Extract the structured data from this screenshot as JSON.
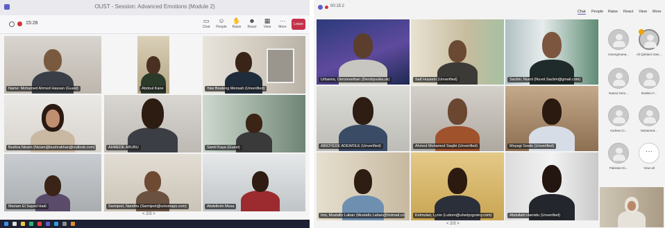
{
  "left_window": {
    "title": "OUST - Session: Advanced Emotions (Module 2)",
    "timer": "15:28",
    "toolbar": [
      {
        "label": "Chat",
        "icon": "chat-icon"
      },
      {
        "label": "People",
        "icon": "people-icon"
      },
      {
        "label": "Raise",
        "icon": "raise-hand-icon"
      },
      {
        "label": "React",
        "icon": "react-icon"
      },
      {
        "label": "View",
        "icon": "view-icon"
      },
      {
        "label": "More",
        "icon": "more-icon"
      },
      {
        "label": "Camera",
        "icon": "camera-icon"
      }
    ],
    "leave_label": "Leave",
    "tiles": [
      {
        "name": "Name: Mohamed Ahmed Hassan (Guest)"
      },
      {
        "name": "Abdoul Kane"
      },
      {
        "name": "Yaw Boateng Mensah (Unverified)"
      },
      {
        "name": "Bushra Nizam (Nizam@bushrakhan@outlook.com)"
      },
      {
        "name": "AHMEDE ABUBU"
      },
      {
        "name": "Samil Kaya (Guest)"
      },
      {
        "name": "Mariam El Sayed Hadi"
      },
      {
        "name": "Sarmjeet, Nandhu (Sarmjeet@uniomaps.com)"
      },
      {
        "name": "Abdelkrim Musa"
      }
    ],
    "pager": "< 2/3 >",
    "taskbar_icons": [
      "start-icon",
      "search-icon",
      "files-icon",
      "browser-icon",
      "mail-icon",
      "teams-icon",
      "store-icon",
      "settings-icon",
      "photos-icon"
    ]
  },
  "right_window": {
    "timer": "00:15:2",
    "tabs": [
      "Chat",
      "People",
      "Raise",
      "React",
      "View",
      "More"
    ],
    "tiles": [
      {
        "name": "Urbanns, Derorevethan (Derobyuoka.uk)"
      },
      {
        "name": "Saif Hussein (Unverified)"
      },
      {
        "name": "Sacbin, Nuvol (Nuvol.Sacbin@gmail.com)"
      },
      {
        "name": "ABIOYEDE ADEWOLE (Unverified)"
      },
      {
        "name": "Ahmed Mohamed Saqibi (Unverified)"
      },
      {
        "name": "Moyagi Sowlo (Unverified)"
      },
      {
        "name": "Ims, Mustafiz Laban (Mustafiz.Laban@hotmail.com)"
      },
      {
        "name": "Kelmulan, Lynio (Lutiom@uhedyrgosiny.com)"
      },
      {
        "name": "Abdullahi Hamidu (Unverified)"
      }
    ],
    "pager": "< 2/3 >",
    "sidebar": [
      {
        "label": "Harergimana..."
      },
      {
        "label": "Ali Qahtani Gasi..."
      },
      {
        "label": "Naeza Gem..."
      },
      {
        "label": "Ibrahim F..."
      },
      {
        "label": "Andrew Ci..."
      },
      {
        "label": "Mohamed..."
      },
      {
        "label": "Pakistan Ni..."
      },
      {
        "label": "View all"
      }
    ]
  }
}
